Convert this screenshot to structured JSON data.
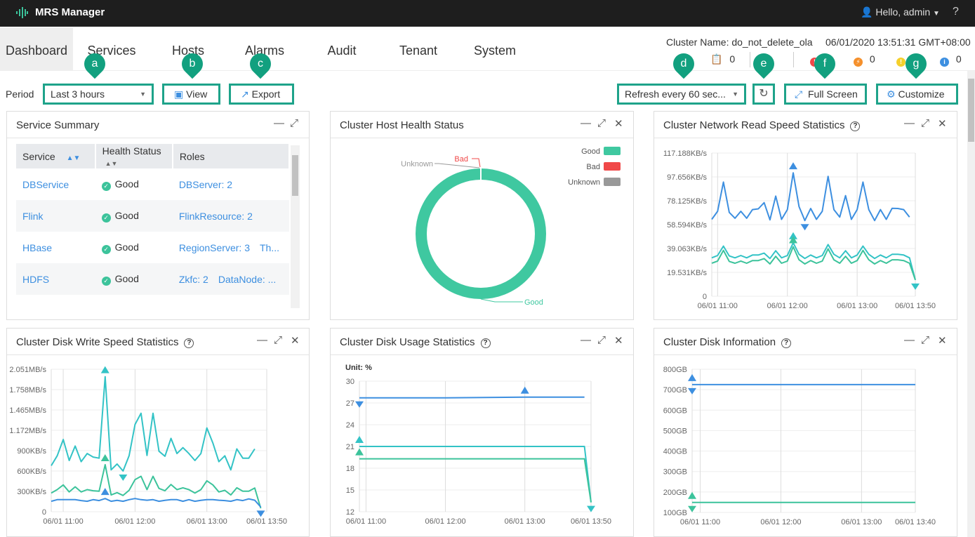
{
  "app": {
    "title": "MRS Manager",
    "user": "Hello, admin",
    "help": "?"
  },
  "nav": {
    "tabs": [
      {
        "label": "Dashboard",
        "active": true
      },
      {
        "label": "Services"
      },
      {
        "label": "Hosts"
      },
      {
        "label": "Alarms"
      },
      {
        "label": "Audit"
      },
      {
        "label": "Tenant"
      },
      {
        "label": "System"
      }
    ]
  },
  "status": {
    "cluster_name": "Cluster Name: do_not_delete_ola",
    "datetime": "06/01/2020 13:51:31 GMT+08:00",
    "tasks_count": "0",
    "major_count": "0",
    "info_count": "0"
  },
  "toolbar": {
    "period_label": "Period",
    "period_value": "Last 3 hours",
    "view": "View",
    "export": "Export",
    "refresh_value": "Refresh every 60 sec...",
    "full_screen": "Full Screen",
    "customize": "Customize"
  },
  "annotations": [
    "a",
    "b",
    "c",
    "d",
    "e",
    "f",
    "g"
  ],
  "colors": {
    "accent": "#1ea38a",
    "blue": "#3d8fe0",
    "teal": "#33c3c6",
    "green": "#3cc39b",
    "bad": "#f04848",
    "unknown": "#999999"
  },
  "service_summary": {
    "title": "Service Summary",
    "columns": [
      "Service",
      "Health Status",
      "Roles"
    ],
    "rows": [
      {
        "service": "DBService",
        "health": "Good",
        "roles": [
          "DBServer: 2"
        ]
      },
      {
        "service": "Flink",
        "health": "Good",
        "roles": [
          "FlinkResource: 2"
        ]
      },
      {
        "service": "HBase",
        "health": "Good",
        "roles": [
          "RegionServer: 3",
          "Th..."
        ]
      },
      {
        "service": "HDFS",
        "health": "Good",
        "roles": [
          "Zkfc: 2",
          "DataNode: ..."
        ]
      }
    ]
  },
  "host_health": {
    "title": "Cluster Host Health Status",
    "legend": [
      "Good",
      "Bad",
      "Unknown"
    ]
  },
  "panel_titles": {
    "net": "Cluster Network Read Speed Statistics",
    "write": "Cluster Disk Write Speed Statistics",
    "usage": "Cluster Disk Usage Statistics",
    "info": "Cluster Disk Information"
  },
  "chart_data": [
    {
      "id": "host-health",
      "type": "pie",
      "donut": true,
      "slices": [
        {
          "label": "Good",
          "value": 100,
          "color": "#3fc8a0"
        },
        {
          "label": "Bad",
          "value": 0,
          "color": "#f04848"
        },
        {
          "label": "Unknown",
          "value": 0,
          "color": "#999999"
        }
      ],
      "legend_placement": "top-right"
    },
    {
      "id": "net-read",
      "type": "line",
      "unit": "KB/s",
      "x_range": [
        "10:55",
        "13:50"
      ],
      "x_ticks": [
        "06/01 11:00",
        "06/01 12:00",
        "06/01 13:00",
        "06/01 13:50"
      ],
      "y_ticks": [
        {
          "v": 0,
          "label": "0"
        },
        {
          "v": 19.531,
          "label": "19.531KB/s"
        },
        {
          "v": 39.063,
          "label": "39.063KB/s"
        },
        {
          "v": 58.594,
          "label": "58.594KB/s"
        },
        {
          "v": 78.125,
          "label": "78.125KB/s"
        },
        {
          "v": 97.656,
          "label": "97.656KB/s"
        },
        {
          "v": 117.188,
          "label": "117.188KB/s"
        }
      ],
      "ylim": [
        0,
        117.188
      ],
      "grid": true,
      "series": [
        {
          "color": "#3d8fe0",
          "x_start": "10:55",
          "step_minutes": 5,
          "markers": [
            "max",
            "min"
          ],
          "values": [
            62.9,
            69.5,
            93.4,
            68.6,
            63.8,
            69.5,
            63.8,
            70.9,
            71.5,
            76.6,
            62.5,
            81.9,
            62.9,
            70.9,
            101,
            73.4,
            61.9,
            71.8,
            62.9,
            69.5,
            98.1,
            70.9,
            64.8,
            82.3,
            62.9,
            70.9,
            93.4,
            70.9,
            61.9,
            70.9,
            62.9,
            72,
            71.8,
            70.9,
            64.8
          ]
        },
        {
          "color": "#33c3c6",
          "x_start": "10:55",
          "step_minutes": 5,
          "markers": [
            "max",
            "min"
          ],
          "values": [
            31.4,
            33.3,
            41,
            33,
            31.4,
            33.3,
            31.4,
            33.7,
            33.7,
            35.3,
            30.9,
            37.2,
            31.4,
            33.3,
            43.8,
            34.3,
            30.9,
            33.7,
            31.4,
            33.3,
            42.3,
            34.3,
            31.4,
            37.2,
            31.4,
            33.7,
            41,
            34.3,
            30.9,
            33.7,
            31.4,
            34.3,
            34.3,
            33.7,
            31.4,
            13.3
          ]
        },
        {
          "color": "#3cc39b",
          "x_start": "10:55",
          "step_minutes": 5,
          "markers": [
            "max"
          ],
          "values": [
            27,
            28.8,
            37.5,
            28.5,
            27,
            28.8,
            27,
            29.2,
            29.2,
            30.8,
            26.4,
            32.7,
            27,
            28.8,
            40.5,
            29.8,
            26.4,
            29.2,
            27,
            28.8,
            38.8,
            29.8,
            27,
            32.7,
            27,
            29.2,
            37.5,
            29.8,
            26.4,
            29.2,
            27,
            29.8,
            29.8,
            29.2,
            27,
            13.3
          ]
        }
      ]
    },
    {
      "id": "disk-write",
      "type": "line",
      "unit": "KB/s",
      "x_range": [
        "10:50",
        "13:50"
      ],
      "x_ticks": [
        "06/01 11:00",
        "06/01 12:00",
        "06/01 13:00",
        "06/01 13:50"
      ],
      "y_ticks": [
        {
          "v": 0,
          "label": "0"
        },
        {
          "v": 300,
          "label": "300KB/s"
        },
        {
          "v": 600,
          "label": "600KB/s"
        },
        {
          "v": 900,
          "label": "900KB/s"
        },
        {
          "v": 1200,
          "label": "1.172MB/s"
        },
        {
          "v": 1500,
          "label": "1.465MB/s"
        },
        {
          "v": 1800,
          "label": "1.758MB/s"
        },
        {
          "v": 2100,
          "label": "2.051MB/s"
        }
      ],
      "ylim": [
        0,
        2100
      ],
      "grid": true,
      "series": [
        {
          "color": "#33c3c6",
          "x_start": "10:50",
          "step_minutes": 5,
          "markers": [
            "max",
            "min"
          ],
          "values": [
            679,
            824,
            1064,
            755,
            968,
            738,
            858,
            806,
            789,
            1990,
            618,
            703,
            600,
            824,
            1287,
            1451,
            830,
            1451,
            892,
            817,
            1081,
            858,
            944,
            858,
            755,
            858,
            1235,
            1012,
            738,
            824,
            618,
            926,
            789,
            789,
            926
          ]
        },
        {
          "color": "#3cc39b",
          "x_start": "10:50",
          "step_minutes": 5,
          "markers": [
            "max"
          ],
          "values": [
            275,
            326,
            395,
            292,
            367,
            292,
            326,
            309,
            302,
            693,
            247,
            281,
            240,
            316,
            474,
            522,
            326,
            522,
            343,
            309,
            401,
            326,
            353,
            326,
            275,
            326,
            456,
            395,
            292,
            316,
            247,
            353,
            302,
            302,
            350,
            51
          ]
        },
        {
          "color": "#3d8fe0",
          "x_start": "10:50",
          "step_minutes": 5,
          "markers": [
            "max",
            "min"
          ],
          "values": [
            154,
            178,
            178,
            178,
            178,
            165,
            154,
            178,
            165,
            195,
            154,
            168,
            154,
            178,
            195,
            178,
            170,
            178,
            154,
            168,
            178,
            178,
            154,
            178,
            154,
            168,
            178,
            178,
            170,
            165,
            154,
            178,
            165,
            189,
            170,
            69
          ]
        }
      ]
    },
    {
      "id": "disk-usage",
      "type": "line",
      "unit": "%",
      "unit_label": "Unit: %",
      "x_range": [
        "10:55",
        "13:50"
      ],
      "x_ticks": [
        "06/01 11:00",
        "06/01 12:00",
        "06/01 13:00",
        "06/01 13:50"
      ],
      "y_ticks": [
        {
          "v": 12,
          "label": "12"
        },
        {
          "v": 15,
          "label": "15"
        },
        {
          "v": 18,
          "label": "18"
        },
        {
          "v": 21,
          "label": "21"
        },
        {
          "v": 24,
          "label": "24"
        },
        {
          "v": 27,
          "label": "27"
        },
        {
          "v": 30,
          "label": "30"
        }
      ],
      "ylim": [
        12,
        30
      ],
      "grid": true,
      "series": [
        {
          "color": "#3d8fe0",
          "markers": [
            "min",
            "max"
          ],
          "points": [
            [
              "10:55",
              27.7
            ],
            [
              "12:00",
              27.7
            ],
            [
              "13:00",
              27.8
            ],
            [
              "13:45",
              27.8
            ]
          ]
        },
        {
          "color": "#33c3c6",
          "markers": [
            "max",
            "min"
          ],
          "points": [
            [
              "10:55",
              21.0
            ],
            [
              "13:45",
              21.0
            ],
            [
              "13:50",
              13.3
            ]
          ]
        },
        {
          "color": "#3cc39b",
          "markers": [
            "max"
          ],
          "points": [
            [
              "10:55",
              19.3
            ],
            [
              "13:45",
              19.3
            ],
            [
              "13:50",
              13.3
            ]
          ]
        }
      ]
    },
    {
      "id": "disk-info",
      "type": "line",
      "unit": "GB",
      "x_range": [
        "10:54",
        "13:40"
      ],
      "x_ticks": [
        "06/01 11:00",
        "06/01 12:00",
        "06/01 13:00",
        "06/01 13:40"
      ],
      "y_ticks": [
        {
          "v": 100,
          "label": "100GB"
        },
        {
          "v": 200,
          "label": "200GB"
        },
        {
          "v": 300,
          "label": "300GB"
        },
        {
          "v": 400,
          "label": "400GB"
        },
        {
          "v": 500,
          "label": "500GB"
        },
        {
          "v": 600,
          "label": "600GB"
        },
        {
          "v": 700,
          "label": "700GB"
        },
        {
          "v": 800,
          "label": "800GB"
        }
      ],
      "ylim": [
        100,
        800
      ],
      "grid": true,
      "series": [
        {
          "color": "#3d8fe0",
          "markers": [
            "min",
            "max"
          ],
          "points": [
            [
              "10:54",
              725
            ],
            [
              "13:40",
              725
            ]
          ]
        },
        {
          "color": "#3cc39b",
          "markers": [
            "min",
            "max"
          ],
          "points": [
            [
              "10:54",
              149
            ],
            [
              "13:40",
              149
            ]
          ]
        }
      ]
    }
  ]
}
